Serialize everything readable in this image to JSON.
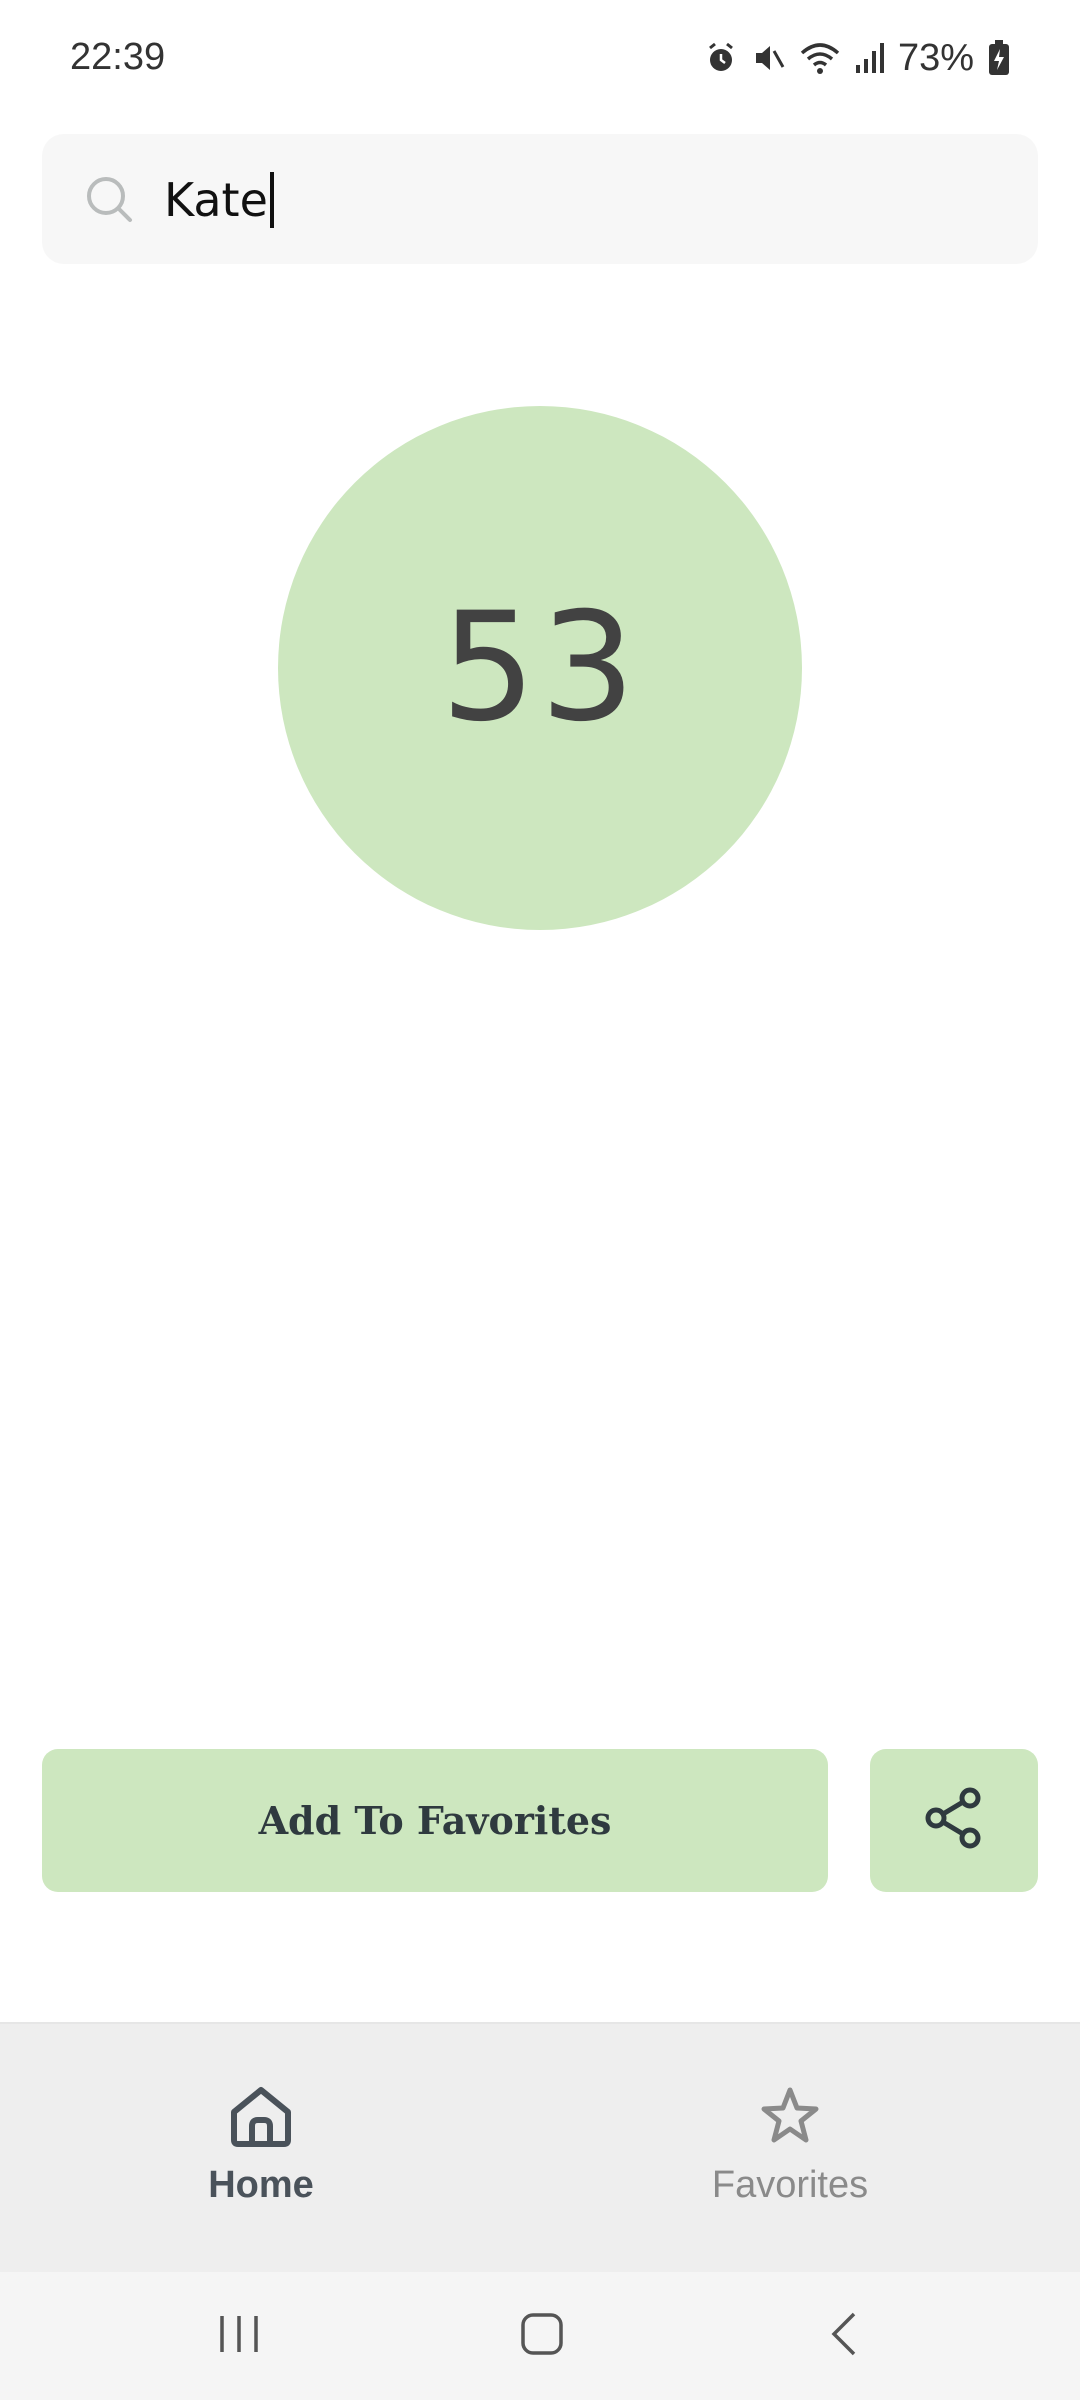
{
  "status_bar": {
    "time": "22:39",
    "battery": "73%",
    "icons": [
      "alarm-icon",
      "mute-icon",
      "wifi-icon",
      "signal-icon",
      "battery-icon"
    ]
  },
  "search": {
    "value": "Kate",
    "icon": "search-icon"
  },
  "result": {
    "number": "53",
    "circle_color": "#cde7bf"
  },
  "actions": {
    "add_favorites_label": "Add To Favorites",
    "share_icon": "share-icon",
    "accent_color": "#cde7bf"
  },
  "bottom_nav": {
    "items": [
      {
        "label": "Home",
        "icon": "home-icon",
        "active": true
      },
      {
        "label": "Favorites",
        "icon": "star-icon",
        "active": false
      }
    ]
  },
  "system_nav": {
    "buttons": [
      "recents-icon",
      "home-button-icon",
      "back-icon"
    ]
  }
}
